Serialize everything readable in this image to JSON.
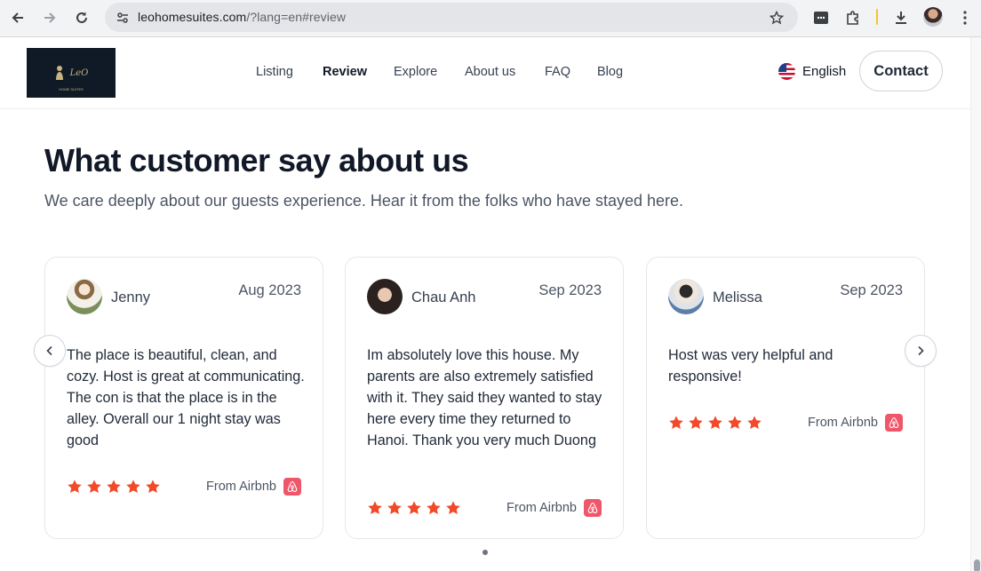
{
  "browser": {
    "url_host": "leohomesuites.com",
    "url_rest": "/?lang=en#review"
  },
  "header": {
    "logo_text": "LeO",
    "logo_sub": "HOME SUITES",
    "menu": [
      "Listing",
      "Review",
      "Explore",
      "About us",
      "FAQ",
      "Blog"
    ],
    "active_menu": "Review",
    "language": "English",
    "contact_label": "Contact"
  },
  "section": {
    "title": "What customer say about us",
    "subtitle": "We care deeply about our guests experience. Hear it from the folks who have stayed here."
  },
  "reviews": [
    {
      "name": "Jenny",
      "date": "Aug 2023",
      "text": "The place is beautiful, clean, and cozy. Host is great at communicating. The con is that the place is in the alley. Overall our 1 night stay was good",
      "rating": 5,
      "source": "From Airbnb"
    },
    {
      "name": "Chau Anh",
      "date": "Sep 2023",
      "text": "Im absolutely love this house. My parents are also extremely satisfied with it. They said they wanted to stay here every time they returned to Hanoi. Thank you very much Duong",
      "rating": 5,
      "source": "From Airbnb"
    },
    {
      "name": "Melissa",
      "date": "Sep 2023",
      "text": "Host was very helpful and responsive!",
      "rating": 5,
      "source": "From Airbnb"
    }
  ],
  "colors": {
    "star": "#f04a2a",
    "airbnb": "#f0566a",
    "heading": "#111827"
  }
}
